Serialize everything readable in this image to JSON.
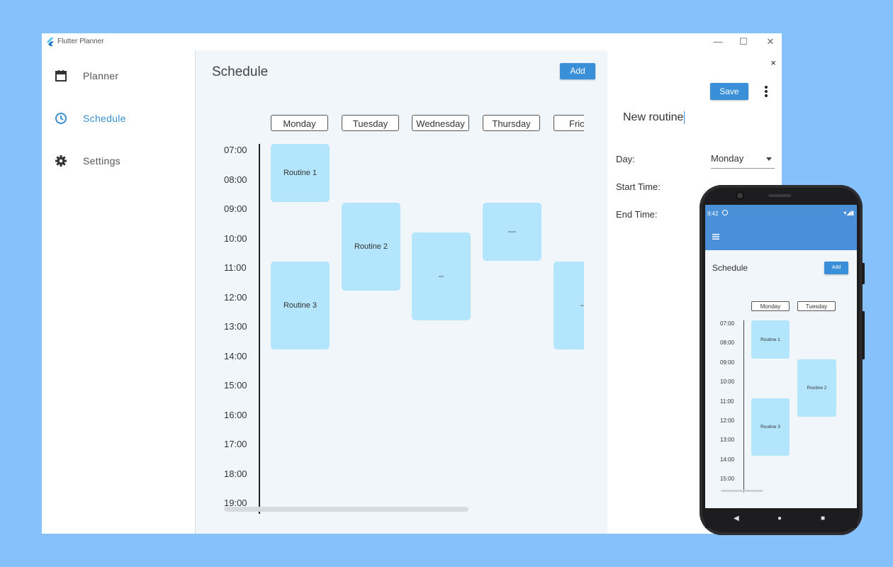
{
  "window": {
    "title": "Flutter Planner",
    "controls": [
      "—",
      "☐",
      "✕"
    ]
  },
  "sidebar": {
    "items": [
      {
        "label": "Planner",
        "icon": "calendar-icon",
        "active": false
      },
      {
        "label": "Schedule",
        "icon": "clock-icon",
        "active": true
      },
      {
        "label": "Settings",
        "icon": "gear-icon",
        "active": false
      }
    ]
  },
  "main": {
    "title": "Schedule",
    "add_label": "Add",
    "days": [
      "Monday",
      "Tuesday",
      "Wednesday",
      "Thursday",
      "Fric"
    ],
    "times": [
      "07:00",
      "08:00",
      "09:00",
      "10:00",
      "11:00",
      "12:00",
      "13:00",
      "14:00",
      "15:00",
      "16:00",
      "17:00",
      "18:00",
      "19:00"
    ],
    "routines": [
      {
        "label": "Routine 1",
        "day": "Monday",
        "start": "07:00",
        "end": "09:00"
      },
      {
        "label": "Routine 3",
        "day": "Monday",
        "start": "11:00",
        "end": "14:00"
      },
      {
        "label": "Routine 2",
        "day": "Tuesday",
        "start": "09:00",
        "end": "12:00"
      },
      {
        "label": "--",
        "day": "Wednesday",
        "start": "10:00",
        "end": "13:00"
      },
      {
        "label": "---",
        "day": "Thursday",
        "start": "09:00",
        "end": "11:00"
      },
      {
        "label": "--",
        "day": "Friday",
        "start": "11:00",
        "end": "14:00"
      }
    ]
  },
  "panel": {
    "close": "×",
    "save_label": "Save",
    "name_value": "New routine",
    "day_label": "Day:",
    "day_value": "Monday",
    "start_label": "Start Time:",
    "end_label": "End Time:"
  },
  "mobile": {
    "status_time": "9:42",
    "status_icons": "▾◢▮",
    "title": "Schedule",
    "add_label": "Add",
    "days": [
      "Monday",
      "Tuesday"
    ],
    "times": [
      "07:00",
      "08:00",
      "09:00",
      "10:00",
      "11:00",
      "12:00",
      "13:00",
      "14:00",
      "15:00"
    ],
    "routines": [
      {
        "label": "Routine 1"
      },
      {
        "label": "Routine 2"
      },
      {
        "label": "Routine 3"
      }
    ],
    "nav": [
      "◀",
      "●",
      "■"
    ]
  },
  "colors": {
    "background": "#86c1fb",
    "accent": "#3a8fd9",
    "routine_fill": "#b3e5fc"
  }
}
